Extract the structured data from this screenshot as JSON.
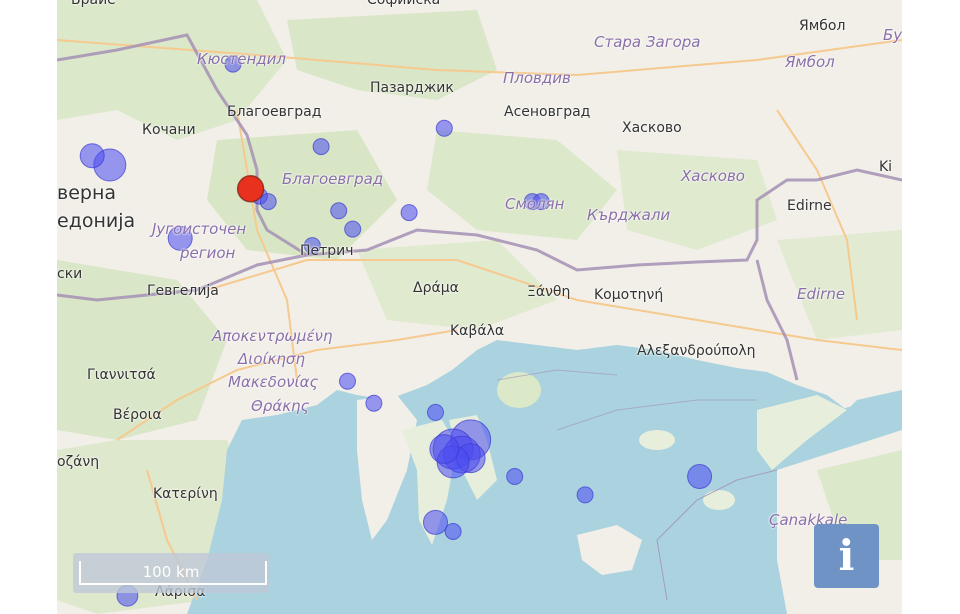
{
  "map": {
    "labels": {
      "sofia": "Софийска",
      "brezhe": "Брайе",
      "kyustendil": "Кюстендил",
      "stara_zagora": "Стара Загора",
      "yambol_city": "Ямбол",
      "yambol_region": "Ямбол",
      "bu": "Бу",
      "pazardzhik": "Пазарджик",
      "plovdiv": "Пловдив",
      "blagoevgrad_city": "Благоевград",
      "asenovgrad": "Асеновград",
      "haskovo_city": "Хасково",
      "haskovo_region": "Хасково",
      "kochani": "Кочани",
      "severna": "верна",
      "makedonija": "едонија",
      "blagoevgrad_region": "Благоевград",
      "smolyan": "Смолян",
      "kardzhali": "Кърджали",
      "edirne_city": "Edirne",
      "ki": "Ki",
      "jugoistochen": "Југоисточен",
      "region": "регион",
      "petrich": "Петрич",
      "ski": "ски",
      "gevgelija": "Гевгелија",
      "drama": "Δράμα",
      "xanthi": "Ξάνθη",
      "komotini": "Κομοτηνή",
      "edirne_region": "Edirne",
      "apokentromeni": "Αποκεντρωμένη",
      "dioikisi": "Διοίκηση",
      "makedonias": "Μακεδονίας",
      "thrakis": "Θράκης",
      "kavala": "Καβάλα",
      "alexandroupoli": "Αλεξανδρούπολη",
      "giannitsa": "Γιαννιτσά",
      "veroia": "Βέροια",
      "kozani": "οζάνη",
      "katerini": "Κατερίνη",
      "canakkale": "Çanakkale",
      "larisa": "Λάρισα"
    },
    "scale_label": "100 km",
    "info_label": "i",
    "colors": {
      "sea": "#aad3df",
      "land": "#f2efe9",
      "forest": "#cfe3b8",
      "border": "#a58fb5",
      "quake": "#4b4bf0",
      "latest_quake": "#e8321e"
    },
    "earthquakes": [
      {
        "lon": 22.8,
        "lat": 42.45,
        "mag": 3.0,
        "latest": false
      },
      {
        "lon": 22.1,
        "lat": 41.9,
        "mag": 4.0,
        "latest": false
      },
      {
        "lon": 22.9,
        "lat": 41.77,
        "mag": 3.5,
        "latest": true
      },
      {
        "lon": 22.95,
        "lat": 41.73,
        "mag": 3.0,
        "latest": false
      },
      {
        "lon": 23.0,
        "lat": 41.7,
        "mag": 3.0,
        "latest": false
      },
      {
        "lon": 23.3,
        "lat": 42.0,
        "mag": 3.0,
        "latest": false
      },
      {
        "lon": 23.4,
        "lat": 41.65,
        "mag": 3.0,
        "latest": false
      },
      {
        "lon": 23.48,
        "lat": 41.55,
        "mag": 3.0,
        "latest": false
      },
      {
        "lon": 23.8,
        "lat": 41.64,
        "mag": 3.0,
        "latest": false
      },
      {
        "lon": 24.0,
        "lat": 42.1,
        "mag": 3.0,
        "latest": false
      },
      {
        "lon": 24.5,
        "lat": 41.7,
        "mag": 3.0,
        "latest": false
      },
      {
        "lon": 24.55,
        "lat": 41.7,
        "mag": 3.0,
        "latest": false
      },
      {
        "lon": 22.5,
        "lat": 41.5,
        "mag": 3.5,
        "latest": false
      },
      {
        "lon": 23.25,
        "lat": 41.46,
        "mag": 3.0,
        "latest": false
      },
      {
        "lon": 23.45,
        "lat": 40.72,
        "mag": 3.0,
        "latest": false
      },
      {
        "lon": 23.6,
        "lat": 40.6,
        "mag": 3.0,
        "latest": false
      },
      {
        "lon": 23.95,
        "lat": 40.55,
        "mag": 3.0,
        "latest": false
      },
      {
        "lon": 24.15,
        "lat": 40.4,
        "mag": 4.5,
        "latest": false
      },
      {
        "lon": 24.05,
        "lat": 40.35,
        "mag": 4.5,
        "latest": false
      },
      {
        "lon": 24.1,
        "lat": 40.32,
        "mag": 4.3,
        "latest": false
      },
      {
        "lon": 24.15,
        "lat": 40.3,
        "mag": 3.8,
        "latest": false
      },
      {
        "lon": 24.05,
        "lat": 40.28,
        "mag": 4.0,
        "latest": false
      },
      {
        "lon": 24.0,
        "lat": 40.35,
        "mag": 3.8,
        "latest": false
      },
      {
        "lon": 24.4,
        "lat": 40.2,
        "mag": 3.0,
        "latest": false
      },
      {
        "lon": 24.8,
        "lat": 40.1,
        "mag": 3.0,
        "latest": false
      },
      {
        "lon": 25.45,
        "lat": 40.2,
        "mag": 3.5,
        "latest": false
      },
      {
        "lon": 23.95,
        "lat": 39.95,
        "mag": 3.5,
        "latest": false
      },
      {
        "lon": 24.05,
        "lat": 39.9,
        "mag": 3.0,
        "latest": false
      },
      {
        "lon": 22.2,
        "lat": 39.55,
        "mag": 3.3,
        "latest": false
      },
      {
        "lon": 22.0,
        "lat": 41.95,
        "mag": 3.5,
        "latest": false
      }
    ]
  }
}
